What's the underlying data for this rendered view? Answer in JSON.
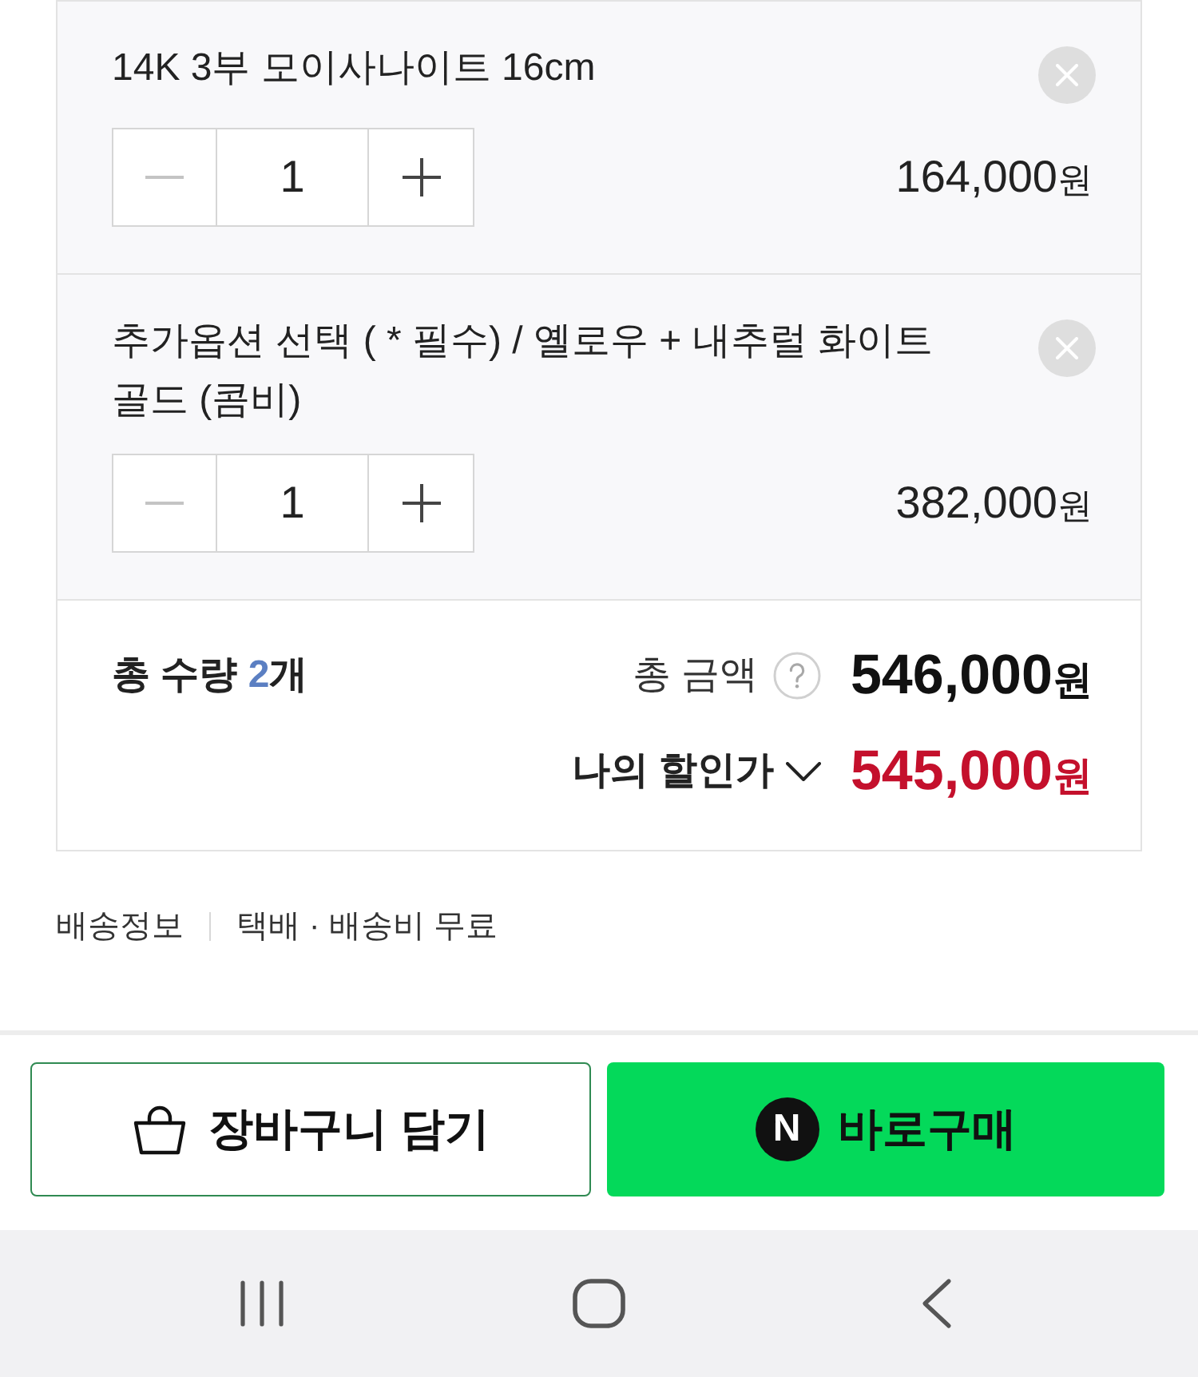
{
  "items": [
    {
      "title": "14K 3부 모이사나이트 16cm",
      "minus_disabled": true,
      "quantity": "1",
      "price": {
        "amount": "164,000",
        "unit": "원"
      }
    },
    {
      "title": "추가옵션 선택 ( * 필수) / 옐로우 + 내추럴 화이트 골드 (콤비)",
      "minus_disabled": true,
      "quantity": "1",
      "price": {
        "amount": "382,000",
        "unit": "원"
      }
    }
  ],
  "summary": {
    "quantity_label": "총 수량",
    "quantity_value": "2",
    "quantity_unit": "개",
    "total_label": "총 금액",
    "total_amount": "546,000",
    "total_unit": "원",
    "discount_label": "나의 할인가",
    "discount_expanded": false,
    "discount_amount": "545,000",
    "discount_unit": "원"
  },
  "delivery": {
    "label": "배송정보",
    "value": "택배 · 배송비 무료"
  },
  "buttons": [
    {
      "kind": "cart",
      "label": "장바구니 담기"
    },
    {
      "kind": "buy",
      "label": "바로구매",
      "logo_letter": "N"
    }
  ]
}
